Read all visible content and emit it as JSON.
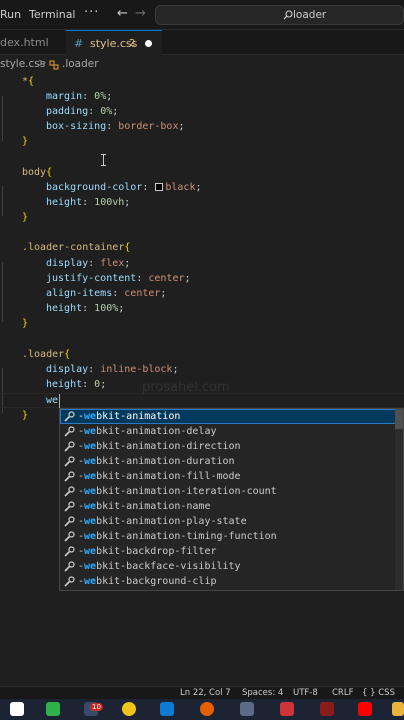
{
  "titlebar": {
    "menu_run": "Run",
    "menu_terminal": "Terminal",
    "menu_more": "···",
    "back_icon": "arrow-left-icon",
    "forward_icon": "arrow-right-icon",
    "search_text": "loader"
  },
  "tabs": [
    {
      "label": "dex.html",
      "active": false
    },
    {
      "label": "style.css",
      "badge": "2",
      "active": true,
      "modified": true
    }
  ],
  "breadcrumb": {
    "file": "style.css",
    "separator": ">",
    "symbol": ".loader"
  },
  "code": {
    "l1_selector": "*",
    "l1_brace": "{",
    "l2_prop": "margin",
    "l2_val": "0%",
    "l3_prop": "padding",
    "l3_val": "0%",
    "l4_prop": "box-sizing",
    "l4_val": "border-box",
    "l5_brace": "}",
    "l7_selector": "body",
    "l7_brace": "{",
    "l8_prop": "background-color",
    "l8_val": "black",
    "l9_prop": "height",
    "l9_val": "100vh",
    "l10_brace": "}",
    "l12_selector": ".loader-container",
    "l12_brace": "{",
    "l13_prop": "display",
    "l13_val": "flex",
    "l14_prop": "justify-content",
    "l14_val": "center",
    "l15_prop": "align-items",
    "l15_val": "center",
    "l16_prop": "height",
    "l16_val": "100%",
    "l17_brace": "}",
    "l19_selector": ".loader",
    "l19_brace": "{",
    "l20_prop": "display",
    "l20_val": "inline-block",
    "l21_prop": "height",
    "l21_val": "0",
    "l22_typed": "we",
    "l23_brace": "}"
  },
  "watermark": "prosahel.com",
  "suggestions": [
    {
      "prefix": "-",
      "match": "we",
      "rest": "bkit-animation",
      "active": true
    },
    {
      "prefix": "-",
      "match": "we",
      "rest": "bkit-animation-delay"
    },
    {
      "prefix": "-",
      "match": "we",
      "rest": "bkit-animation-direction"
    },
    {
      "prefix": "-",
      "match": "we",
      "rest": "bkit-animation-duration"
    },
    {
      "prefix": "-",
      "match": "we",
      "rest": "bkit-animation-fill-mode"
    },
    {
      "prefix": "-",
      "match": "we",
      "rest": "bkit-animation-iteration-count"
    },
    {
      "prefix": "-",
      "match": "we",
      "rest": "bkit-animation-name"
    },
    {
      "prefix": "-",
      "match": "we",
      "rest": "bkit-animation-play-state"
    },
    {
      "prefix": "-",
      "match": "we",
      "rest": "bkit-animation-timing-function"
    },
    {
      "prefix": "-",
      "match": "we",
      "rest": "bkit-backdrop-filter"
    },
    {
      "prefix": "-",
      "match": "we",
      "rest": "bkit-backface-visibility"
    },
    {
      "prefix": "-",
      "match": "we",
      "rest": "bkit-background-clip"
    }
  ],
  "statusbar": {
    "position": "Ln 22, Col 7",
    "spaces": "Spaces: 4",
    "encoding": "UTF-8",
    "eol": "CRLF",
    "language": "CSS"
  },
  "taskbar": {
    "badge": "10",
    "apps": [
      "chrome-icon",
      "store-icon",
      "edge-icon",
      "vscode-icon",
      "firefox-icon",
      "terminal-icon",
      "mail-icon",
      "youtube-icon",
      "folder-icon"
    ]
  },
  "colors": {
    "accent": "#0078d4",
    "modified_tab": "#e2c08d",
    "match_highlight": "#2aaaff",
    "selection": "#04395e"
  }
}
